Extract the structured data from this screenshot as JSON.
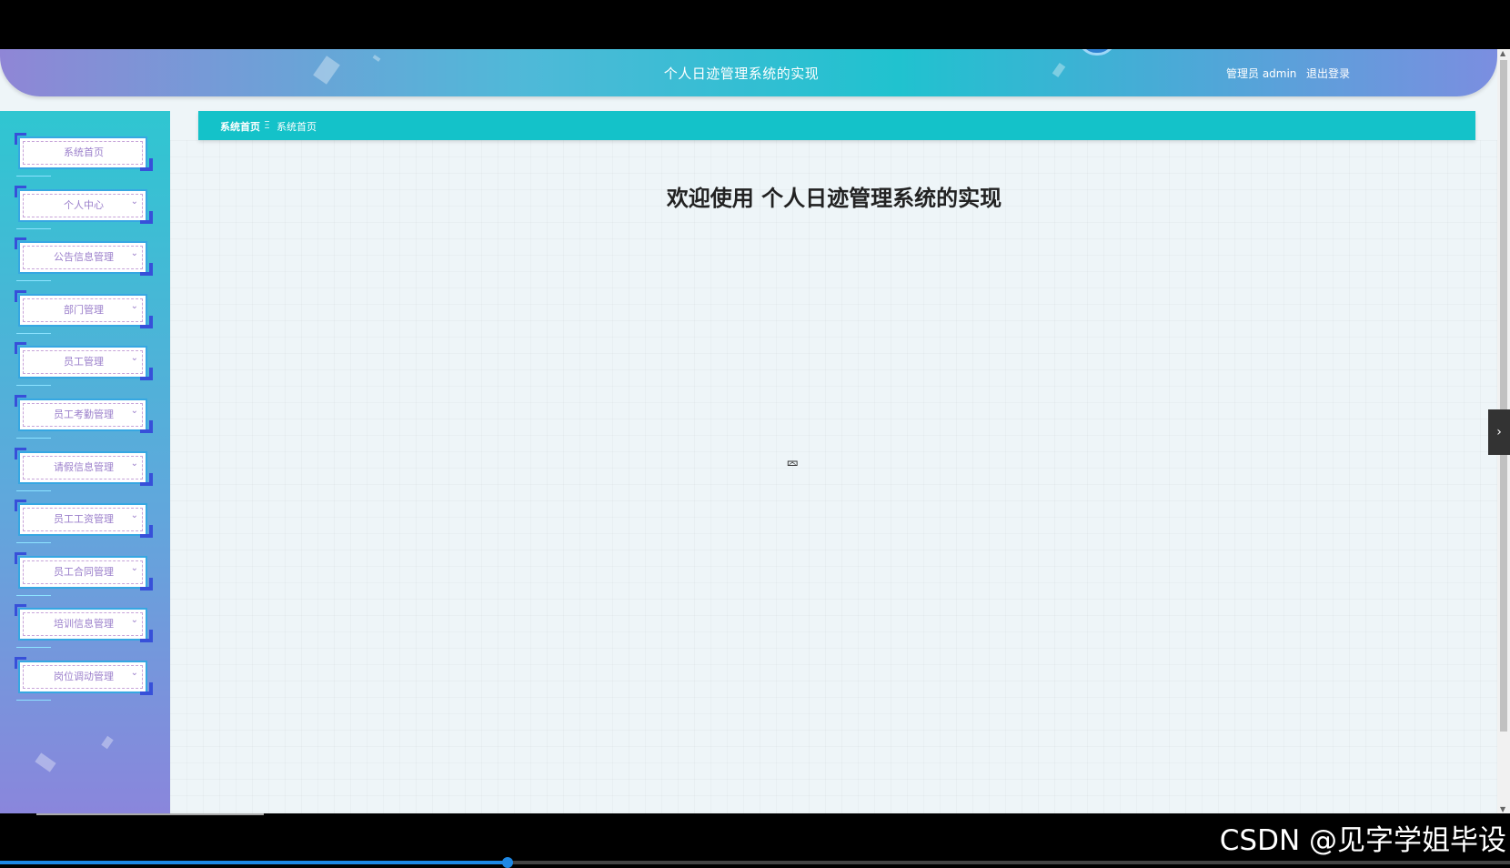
{
  "header": {
    "title": "个人日迹管理系统的实现",
    "user": "管理员 admin",
    "logout": "退出登录"
  },
  "sidebar": {
    "items": [
      {
        "label": "系统首页",
        "expandable": false
      },
      {
        "label": "个人中心",
        "expandable": true
      },
      {
        "label": "公告信息管理",
        "expandable": true
      },
      {
        "label": "部门管理",
        "expandable": true
      },
      {
        "label": "员工管理",
        "expandable": true
      },
      {
        "label": "员工考勤管理",
        "expandable": true
      },
      {
        "label": "请假信息管理",
        "expandable": true
      },
      {
        "label": "员工工资管理",
        "expandable": true
      },
      {
        "label": "员工合同管理",
        "expandable": true
      },
      {
        "label": "培训信息管理",
        "expandable": true
      },
      {
        "label": "岗位调动管理",
        "expandable": true
      }
    ]
  },
  "breadcrumb": {
    "home": "系统首页",
    "separator": "Ξ",
    "current": "系统首页"
  },
  "main": {
    "welcome": "欢迎使用 个人日迹管理系统的实现"
  },
  "side_toggle": "›",
  "watermark": "CSDN @见字学姐毕设",
  "video_progress": 0.336,
  "colors": {
    "crumbbar": "#14c2c9",
    "sidebar_top": "#2fc6d1",
    "sidebar_bottom": "#8a86dc",
    "menu_text": "#9b7fcb"
  }
}
